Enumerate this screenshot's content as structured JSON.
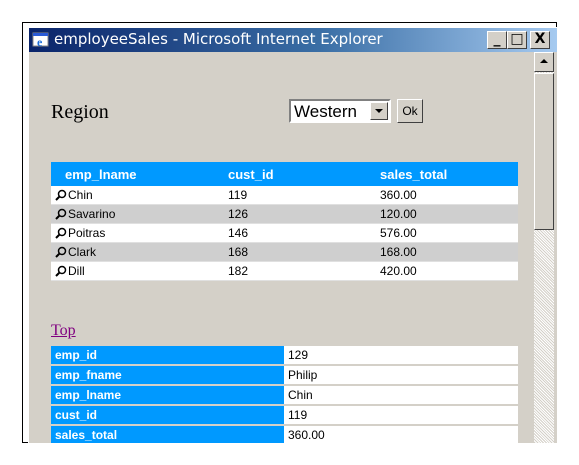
{
  "window": {
    "title": "employeeSales - Microsoft Internet Explorer",
    "minimize": "_",
    "maximize": "□",
    "close": "X"
  },
  "form": {
    "region_label": "Region",
    "region_value": "Western",
    "ok_label": "Ok"
  },
  "table": {
    "headers": [
      "emp_lname",
      "cust_id",
      "sales_total"
    ],
    "rows": [
      {
        "emp_lname": "Chin",
        "cust_id": "119",
        "sales_total": "360.00"
      },
      {
        "emp_lname": "Savarino",
        "cust_id": "126",
        "sales_total": "120.00"
      },
      {
        "emp_lname": "Poitras",
        "cust_id": "146",
        "sales_total": "576.00"
      },
      {
        "emp_lname": "Clark",
        "cust_id": "168",
        "sales_total": "168.00"
      },
      {
        "emp_lname": "Dill",
        "cust_id": "182",
        "sales_total": "420.00"
      }
    ]
  },
  "top_link": "Top",
  "detail": [
    {
      "label": "emp_id",
      "value": "129"
    },
    {
      "label": "emp_fname",
      "value": "Philip"
    },
    {
      "label": "emp_lname",
      "value": "Chin"
    },
    {
      "label": "cust_id",
      "value": "119"
    },
    {
      "label": "sales_total",
      "value": "360.00"
    }
  ],
  "colors": {
    "header_blue": "#0099ff",
    "title_bar": "#0a246a",
    "link_visited": "#800080"
  },
  "icons": {
    "row_icon": "magnifier-icon",
    "app_icon": "internet-explorer-icon"
  }
}
